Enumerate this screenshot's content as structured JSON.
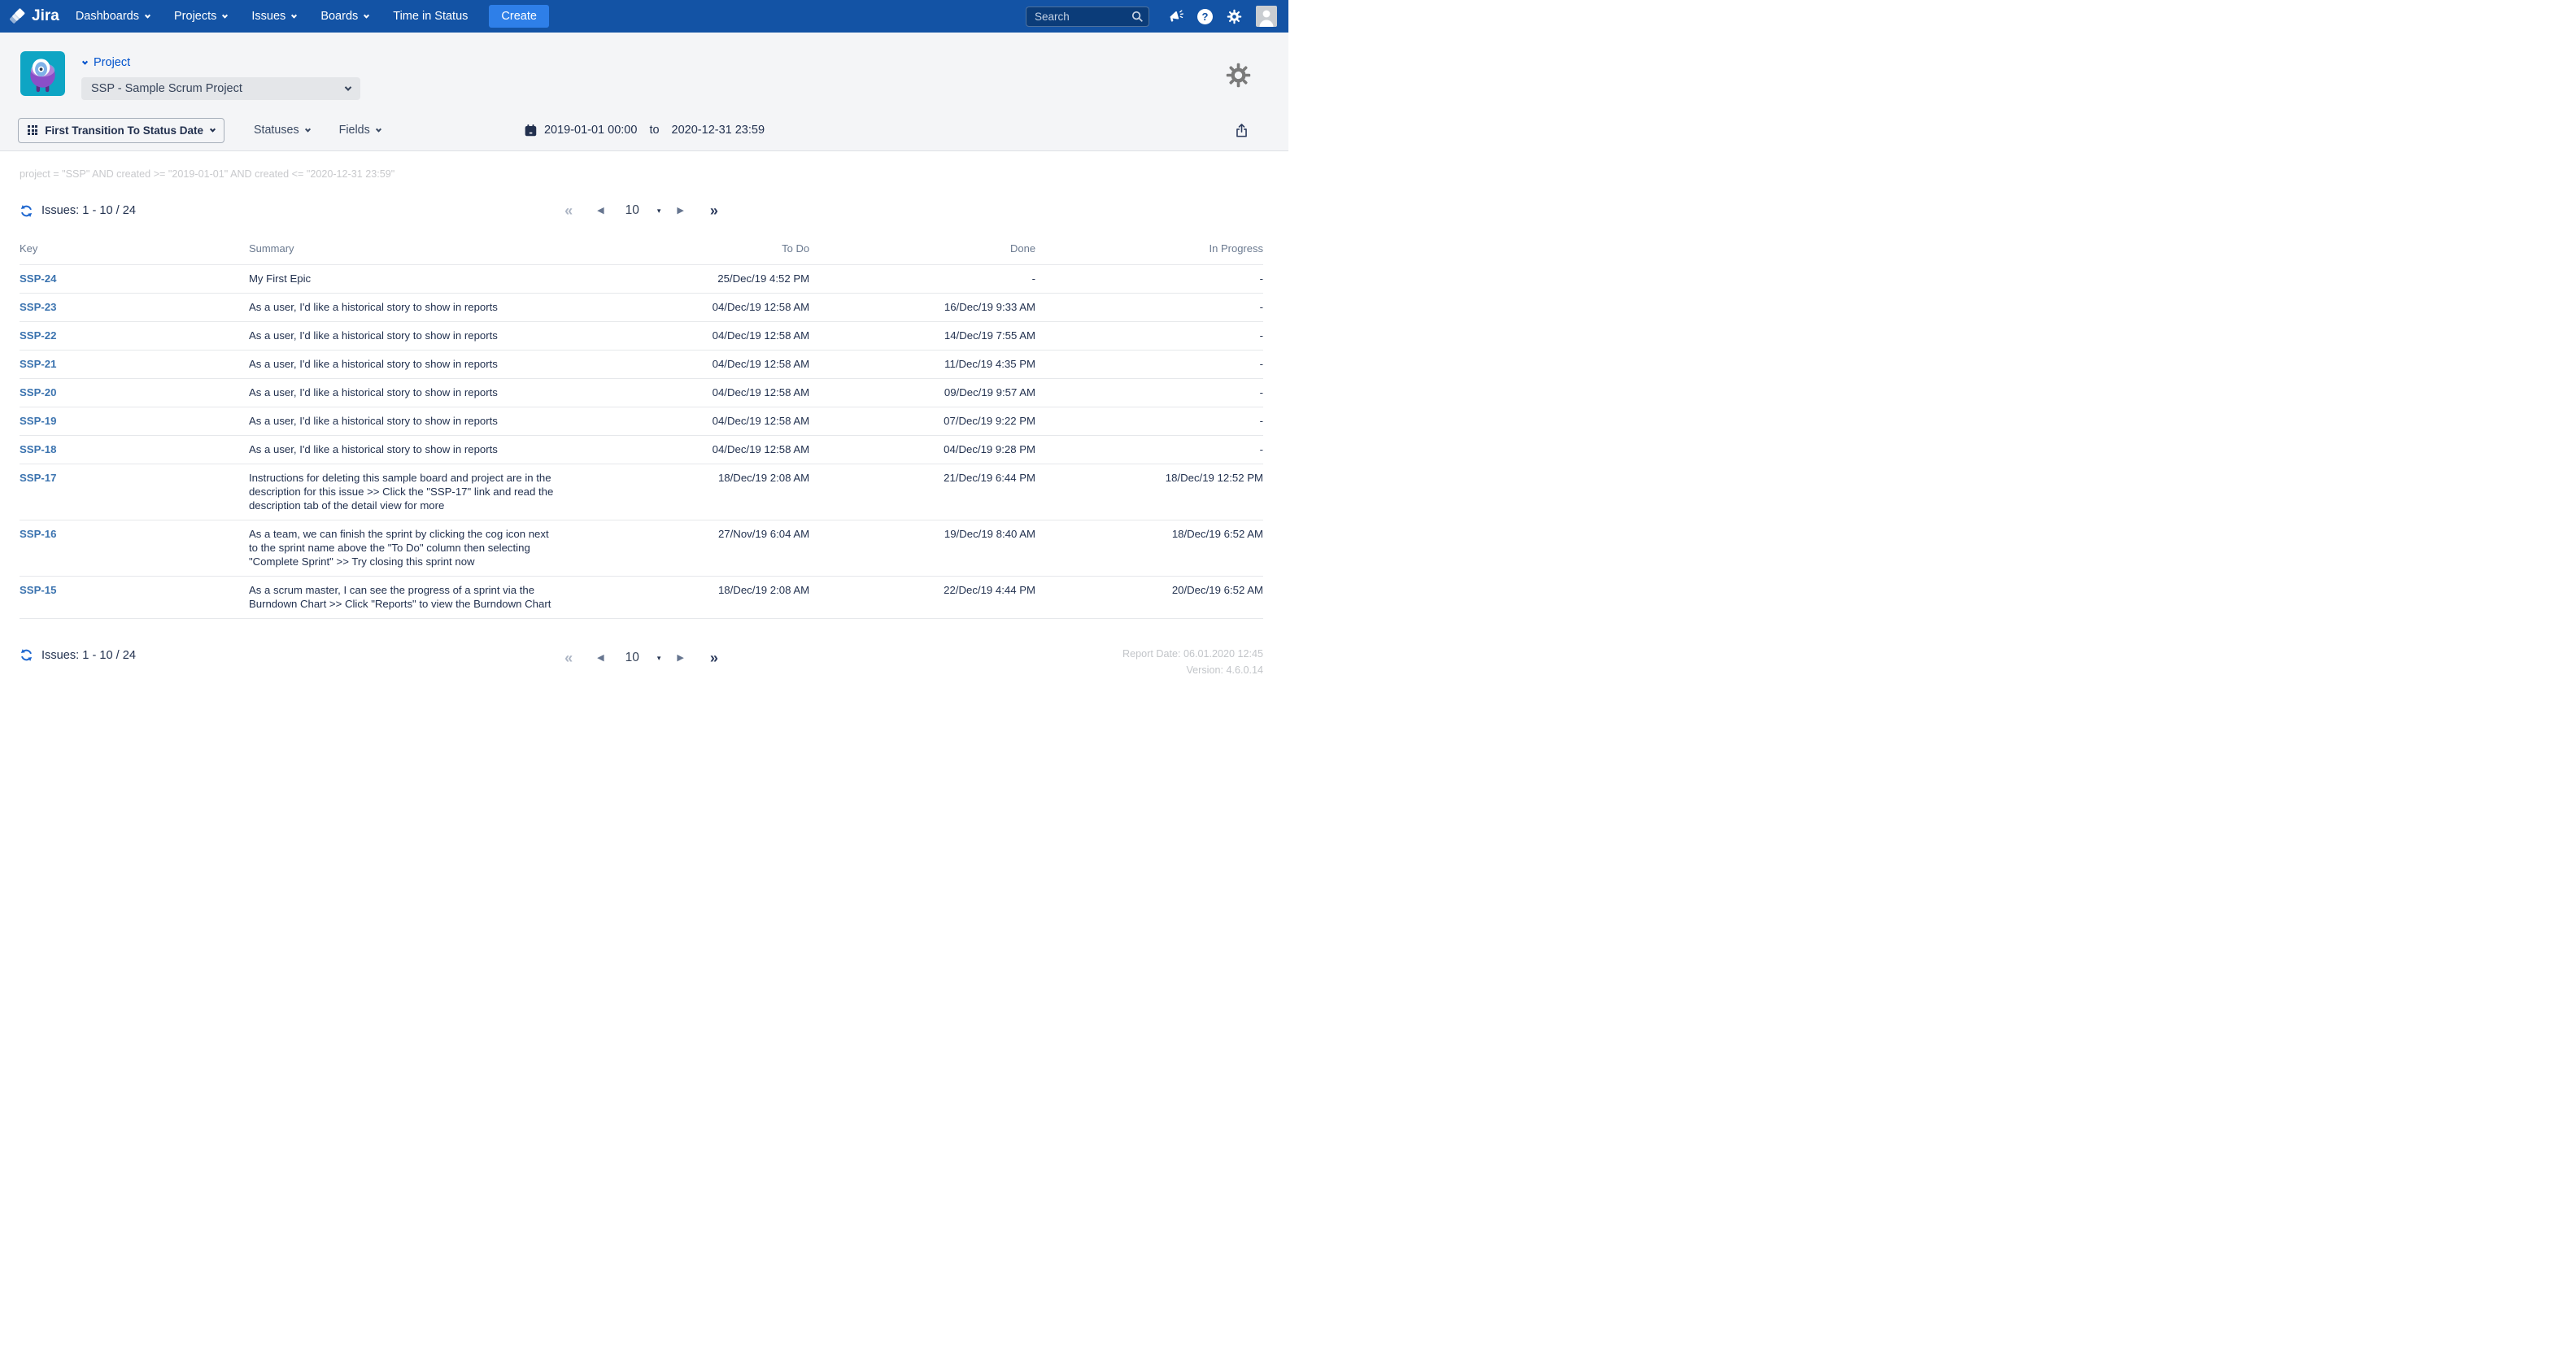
{
  "nav": {
    "brand": "Jira",
    "items": [
      {
        "label": "Dashboards"
      },
      {
        "label": "Projects"
      },
      {
        "label": "Issues"
      },
      {
        "label": "Boards"
      },
      {
        "label": "Time in Status"
      }
    ],
    "create_label": "Create",
    "search_placeholder": "Search"
  },
  "header": {
    "project_label": "Project",
    "project_select_value": "SSP - Sample Scrum Project"
  },
  "toolbar": {
    "report_type": "First Transition To Status Date",
    "statuses_label": "Statuses",
    "fields_label": "Fields",
    "date_from": "2019-01-01 00:00",
    "date_separator": "to",
    "date_to": "2020-12-31 23:59"
  },
  "jql": "project = \"SSP\" AND created >= \"2019-01-01\" AND created <= \"2020-12-31 23:59\"",
  "issues_counter": "Issues: 1 - 10 / 24",
  "pagination": {
    "first": "«",
    "prev": "◀",
    "page_size": "10",
    "caret": "▾",
    "next": "▶",
    "last": "»"
  },
  "table": {
    "columns": [
      "Key",
      "Summary",
      "To Do",
      "Done",
      "In Progress"
    ],
    "rows": [
      {
        "key": "SSP-24",
        "summary": "My First Epic",
        "todo": "25/Dec/19 4:52 PM",
        "done": "-",
        "inprogress": "-"
      },
      {
        "key": "SSP-23",
        "summary": "As a user, I'd like a historical story to show in reports",
        "todo": "04/Dec/19 12:58 AM",
        "done": "16/Dec/19 9:33 AM",
        "inprogress": "-"
      },
      {
        "key": "SSP-22",
        "summary": "As a user, I'd like a historical story to show in reports",
        "todo": "04/Dec/19 12:58 AM",
        "done": "14/Dec/19 7:55 AM",
        "inprogress": "-"
      },
      {
        "key": "SSP-21",
        "summary": "As a user, I'd like a historical story to show in reports",
        "todo": "04/Dec/19 12:58 AM",
        "done": "11/Dec/19 4:35 PM",
        "inprogress": "-"
      },
      {
        "key": "SSP-20",
        "summary": "As a user, I'd like a historical story to show in reports",
        "todo": "04/Dec/19 12:58 AM",
        "done": "09/Dec/19 9:57 AM",
        "inprogress": "-"
      },
      {
        "key": "SSP-19",
        "summary": "As a user, I'd like a historical story to show in reports",
        "todo": "04/Dec/19 12:58 AM",
        "done": "07/Dec/19 9:22 PM",
        "inprogress": "-"
      },
      {
        "key": "SSP-18",
        "summary": "As a user, I'd like a historical story to show in reports",
        "todo": "04/Dec/19 12:58 AM",
        "done": "04/Dec/19 9:28 PM",
        "inprogress": "-"
      },
      {
        "key": "SSP-17",
        "summary": "Instructions for deleting this sample board and project are in the description for this issue >> Click the \"SSP-17\" link and read the description tab of the detail view for more",
        "todo": "18/Dec/19 2:08 AM",
        "done": "21/Dec/19 6:44 PM",
        "inprogress": "18/Dec/19 12:52 PM"
      },
      {
        "key": "SSP-16",
        "summary": "As a team, we can finish the sprint by clicking the cog icon next to the sprint name above the \"To Do\" column then selecting \"Complete Sprint\" >> Try closing this sprint now",
        "todo": "27/Nov/19 6:04 AM",
        "done": "19/Dec/19 8:40 AM",
        "inprogress": "18/Dec/19 6:52 AM"
      },
      {
        "key": "SSP-15",
        "summary": "As a scrum master, I can see the progress of a sprint via the Burndown Chart >> Click \"Reports\" to view the Burndown Chart",
        "todo": "18/Dec/19 2:08 AM",
        "done": "22/Dec/19 4:44 PM",
        "inprogress": "20/Dec/19 6:52 AM"
      }
    ]
  },
  "footer": {
    "report_date": "Report Date: 06.01.2020 12:45",
    "version": "Version: 4.6.0.14"
  }
}
